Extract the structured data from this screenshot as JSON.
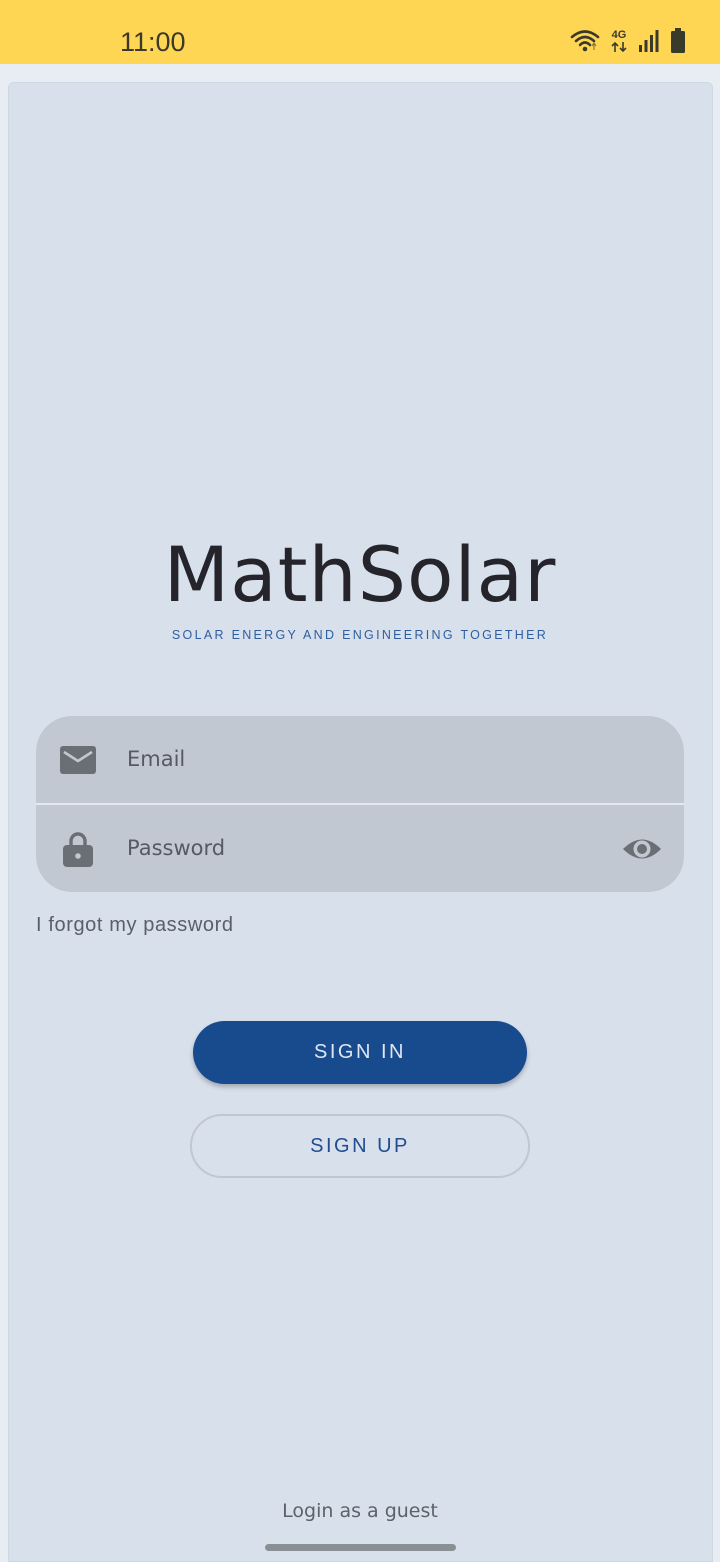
{
  "status_bar": {
    "time": "11:00",
    "network": "4G",
    "icons": [
      "wifi-icon",
      "mobile-data-icon",
      "signal-icon",
      "battery-icon"
    ]
  },
  "app": {
    "title": "MathSolar",
    "subtitle": "SOLAR ENERGY AND ENGINEERING TOGETHER"
  },
  "form": {
    "email_placeholder": "Email",
    "password_placeholder": "Password",
    "forgot_password": "I forgot my password"
  },
  "actions": {
    "sign_in": "SIGN IN",
    "sign_up": "SIGN UP",
    "guest": "Login as a guest"
  },
  "colors": {
    "status_bar": "#ffd554",
    "background": "#d8e0ec",
    "primary": "#184a8e",
    "input_fill": "#c2c8d2"
  }
}
